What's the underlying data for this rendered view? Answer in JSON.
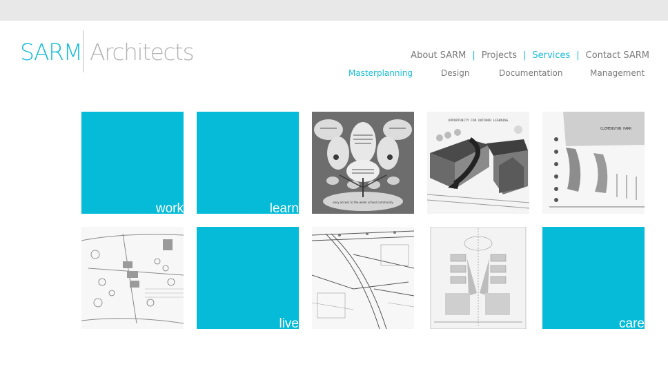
{
  "logo": {
    "primary": "SARM",
    "secondary": "Architects"
  },
  "main_nav": [
    {
      "label": "About SARM",
      "active": false
    },
    {
      "label": "Projects",
      "active": false
    },
    {
      "label": "Services",
      "active": true
    },
    {
      "label": "Contact SARM",
      "active": false
    }
  ],
  "nav_separator": "|",
  "sub_nav": [
    {
      "label": "Masterplanning",
      "active": true
    },
    {
      "label": "Design",
      "active": false
    },
    {
      "label": "Documentation",
      "active": false
    },
    {
      "label": "Management",
      "active": false
    }
  ],
  "tiles": {
    "work": "work",
    "learn": "learn",
    "live": "live",
    "care": "care"
  },
  "images": {
    "diagram_caption": "easy access to the wider school community",
    "perspective_title": "OPPORTUNITY FOR OUTDOOR LEARNING",
    "park_name": "CLEMENSTON PARK"
  },
  "colors": {
    "accent": "#16bcd8",
    "tile": "#05bbd8",
    "topbar": "#e8e8e8",
    "text": "#7a7a7a"
  }
}
